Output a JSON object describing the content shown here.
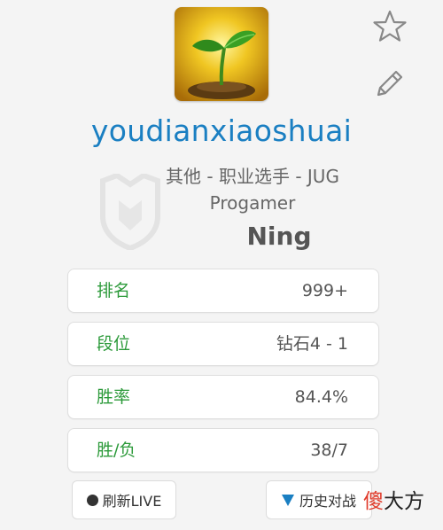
{
  "profile": {
    "username": "youdianxiaoshuai",
    "subtitle_line1": "其他 - 职业选手 - JUG",
    "subtitle_line2": "Progamer",
    "real_name": "Ning"
  },
  "icons": {
    "favorite": "star-icon",
    "edit": "pencil-icon",
    "avatar": "sprout-avatar",
    "watermark": "team-logo-watermark"
  },
  "stats": [
    {
      "label": "排名",
      "value": "999+"
    },
    {
      "label": "段位",
      "value": "钻石4 - 1"
    },
    {
      "label": "胜率",
      "value": "84.4%"
    },
    {
      "label": "胜/负",
      "value": "38/7"
    }
  ],
  "actions": {
    "refresh_label": "刷新LIVE",
    "history_label": "历史对战"
  },
  "branding": {
    "logo_first_char": "傻",
    "logo_rest": "大方"
  },
  "colors": {
    "username": "#1a7fc2",
    "stat_label": "#2c9a3a",
    "history_arrow": "#1a7fc2",
    "logo_accent": "#e03a2a"
  }
}
